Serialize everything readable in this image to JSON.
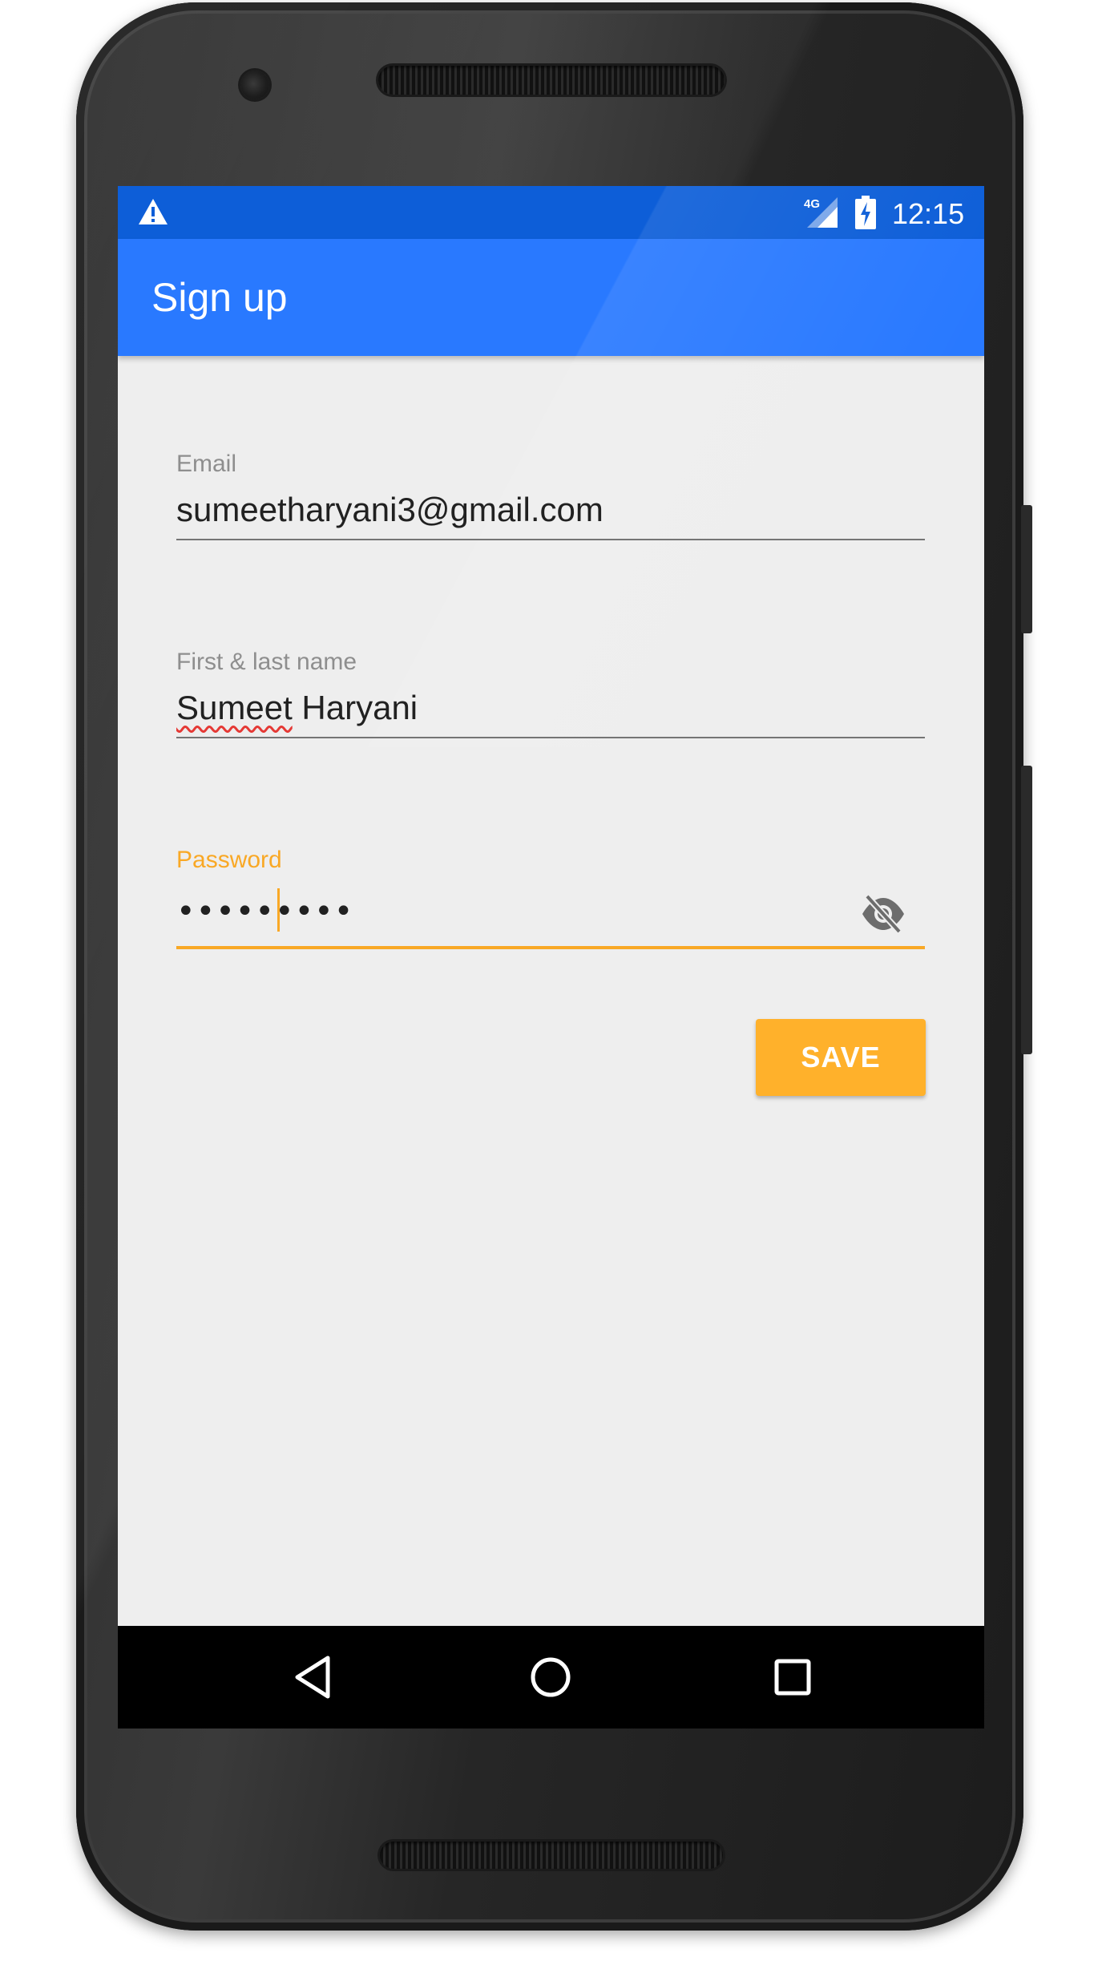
{
  "status_bar": {
    "network_label": "4G",
    "time": "12:15",
    "warning_icon": "warning-triangle-icon",
    "signal_icon": "cell-signal-icon",
    "battery_icon": "battery-charging-icon",
    "background": "#0d5ed8"
  },
  "app_bar": {
    "title": "Sign up",
    "background": "#2979ff"
  },
  "form": {
    "email": {
      "label": "Email",
      "value": "sumeetharyani3@gmail.com"
    },
    "name": {
      "label": "First & last name",
      "value_first": "Sumeet",
      "value_rest": " Haryani"
    },
    "password": {
      "label": "Password",
      "value": "•••••••••",
      "toggle_icon": "visibility-off-icon",
      "accent": "#f9a825"
    }
  },
  "save_button": {
    "label": "SAVE",
    "background": "#ffb12b"
  },
  "nav_bar": {
    "back_icon": "back-triangle-icon",
    "home_icon": "home-circle-icon",
    "recents_icon": "recents-square-icon"
  }
}
